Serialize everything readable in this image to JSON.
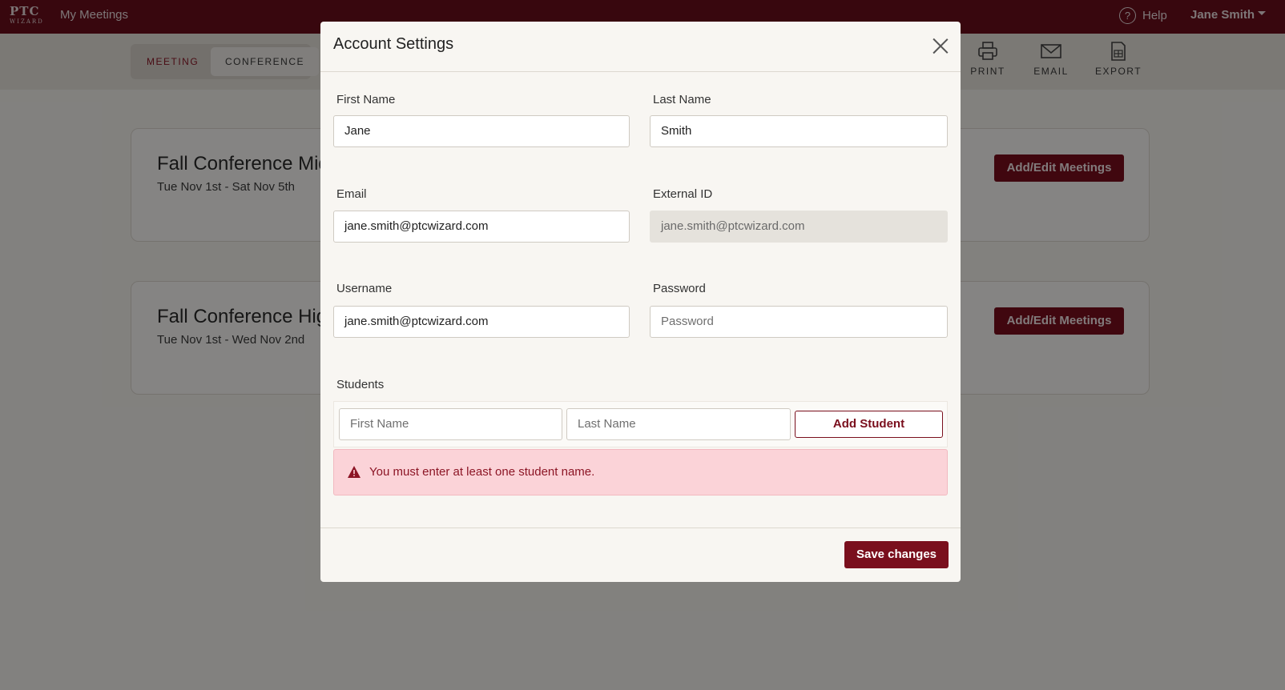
{
  "nav": {
    "logo_mark": "PTC",
    "logo_sub": "WIZARD",
    "my_meetings": "My Meetings",
    "help_label": "Help",
    "help_icon_glyph": "?",
    "user_name": "Jane Smith"
  },
  "toolbar": {
    "tab_meeting": "MEETING",
    "tab_conference": "CONFERENCE",
    "print": "PRINT",
    "email": "EMAIL",
    "export": "EXPORT"
  },
  "conferences": [
    {
      "title": "Fall Conference Midd",
      "dates": "Tue Nov 1st - Sat Nov 5th",
      "button": "Add/Edit Meetings"
    },
    {
      "title": "Fall Conference High",
      "dates": "Tue Nov 1st - Wed Nov 2nd",
      "button": "Add/Edit Meetings"
    }
  ],
  "modal": {
    "title": "Account Settings",
    "first_name_label": "First Name",
    "first_name_value": "Jane",
    "last_name_label": "Last Name",
    "last_name_value": "Smith",
    "email_label": "Email",
    "email_value": "jane.smith@ptcwizard.com",
    "external_id_label": "External ID",
    "external_id_value": "jane.smith@ptcwizard.com",
    "username_label": "Username",
    "username_value": "jane.smith@ptcwizard.com",
    "password_label": "Password",
    "password_placeholder": "Password",
    "students_label": "Students",
    "student_first_placeholder": "First Name",
    "student_last_placeholder": "Last Name",
    "add_student": "Add Student",
    "alert_message": "You must enter at least one student name.",
    "save_changes": "Save changes"
  },
  "colors": {
    "brand": "#6a0f1c",
    "button": "#7a0f1d",
    "alert_bg": "#fbd3d8",
    "alert_text": "#8c1525"
  }
}
